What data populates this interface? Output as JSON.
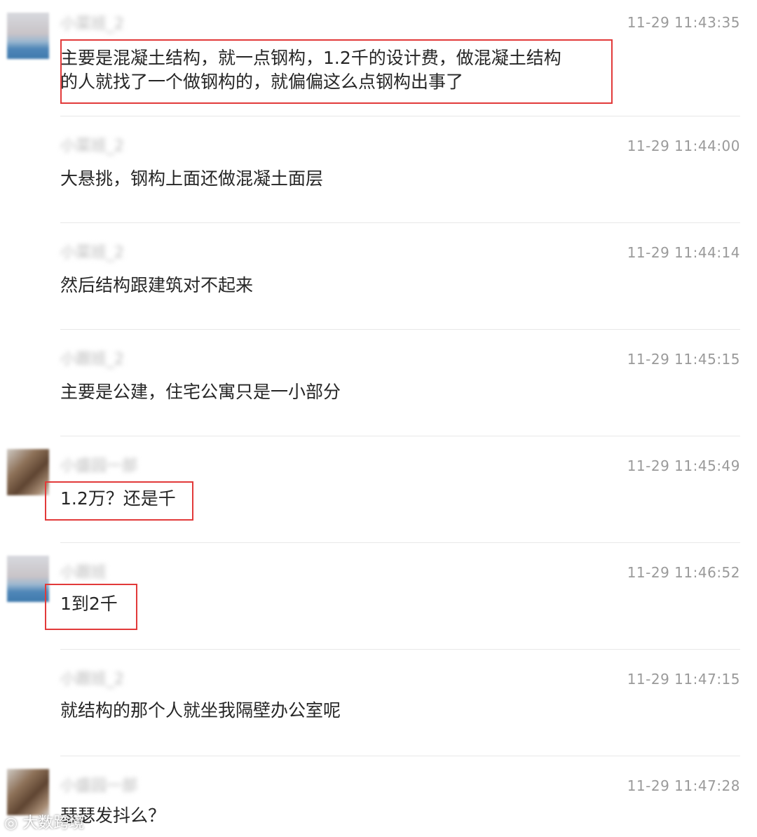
{
  "messages": [
    {
      "name": "小菜班_2",
      "time": "11-29 11:43:35",
      "text": "主要是混凝土结构，就一点钢构，1.2千的设计费，做混凝土结构\n的人就找了一个做钢构的，就偏偏这么点钢构出事了"
    },
    {
      "name": "小菜班_2",
      "time": "11-29 11:44:00",
      "text": "大悬挑，钢构上面还做混凝土面层"
    },
    {
      "name": "小菜班_2",
      "time": "11-29 11:44:14",
      "text": "然后结构跟建筑对不起来"
    },
    {
      "name": "小跟班_2",
      "time": "11-29 11:45:15",
      "text": "主要是公建，住宅公寓只是一小部分"
    },
    {
      "name": "小盛园一部",
      "time": "11-29 11:45:49",
      "text": "1.2万？还是千"
    },
    {
      "name": "小跟班",
      "time": "11-29 11:46:52",
      "text": "1到2千"
    },
    {
      "name": "小跟班_2",
      "time": "11-29 11:47:15",
      "text": "就结构的那个人就坐我隔壁办公室呢"
    },
    {
      "name": "小盛园一部",
      "time": "11-29 11:47:28",
      "text": "瑟瑟发抖么？"
    }
  ],
  "watermark": "大数跨境",
  "colors": {
    "highlight": "#e23a3a",
    "timestamp": "#9a9a9a",
    "separator": "#e8e8e8"
  }
}
